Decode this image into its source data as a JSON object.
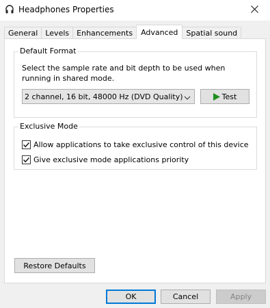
{
  "window": {
    "title": "Headphones Properties",
    "close_glyph": "✕"
  },
  "tabs": [
    {
      "label": "General"
    },
    {
      "label": "Levels"
    },
    {
      "label": "Enhancements"
    },
    {
      "label": "Advanced",
      "active": true
    },
    {
      "label": "Spatial sound"
    }
  ],
  "default_format": {
    "legend": "Default Format",
    "description": "Select the sample rate and bit depth to be used when running in shared mode.",
    "selected_format": "2 channel, 16 bit, 48000 Hz (DVD Quality)",
    "test_label": "Test"
  },
  "exclusive_mode": {
    "legend": "Exclusive Mode",
    "options": [
      {
        "label": "Allow applications to take exclusive control of this device",
        "checked": true
      },
      {
        "label": "Give exclusive mode applications priority",
        "checked": true
      }
    ]
  },
  "restore_label": "Restore Defaults",
  "footer": {
    "ok_label": "OK",
    "cancel_label": "Cancel",
    "apply_label": "Apply"
  },
  "colors": {
    "accent": "#0078d7",
    "play_icon": "#1e8f1e"
  }
}
